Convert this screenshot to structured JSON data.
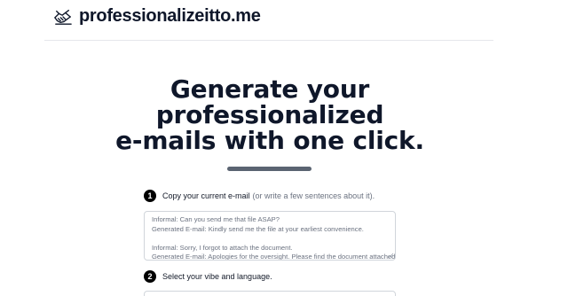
{
  "header": {
    "brand": "professionalizeitto.me",
    "logo_icon": "handshake-icon"
  },
  "hero": {
    "line1": "Generate your",
    "line2": "professionalized",
    "line3": "e-mails with one click."
  },
  "steps": [
    {
      "number": "1",
      "text": "Copy your current e-mail",
      "hint": "(or write a few sentences about it)."
    },
    {
      "number": "2",
      "text": "Select your vibe and language.",
      "hint": ""
    }
  ],
  "email_input": {
    "lines": [
      "Informal: Can you send me that file ASAP?",
      "Generated E-mail: Kindly send me the file at your earliest convenience.",
      "",
      "Informal: Sorry, I forgot to attach the document.",
      "Generated E-mail: Apologies for the oversight. Please find the document attached."
    ]
  },
  "colors": {
    "heading": "#0f172a",
    "divider": "#5b6472",
    "hint": "#6b7280"
  }
}
